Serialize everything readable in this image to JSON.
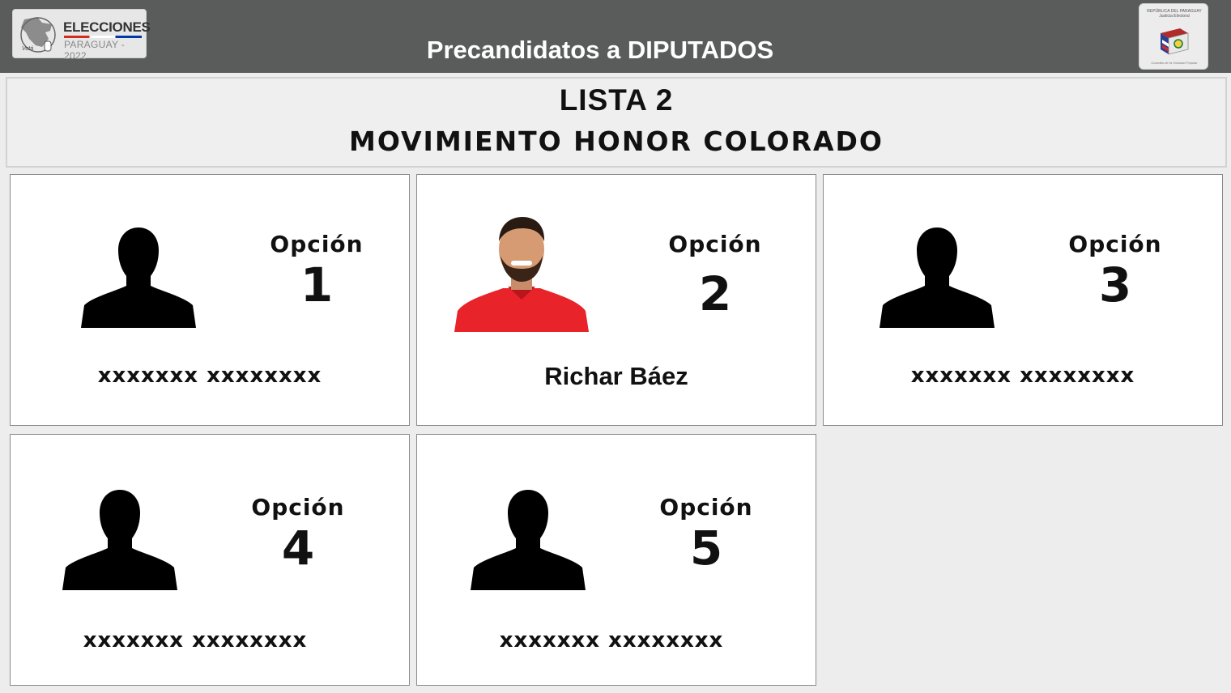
{
  "header": {
    "title": "Precandidatos a DIPUTADOS",
    "logo_left": {
      "title": "ELECCIONES",
      "subtitle": "PARAGUAY - 2022",
      "tagline": "Votá"
    },
    "logo_right": {
      "top_text": "REPÚBLICA DEL PARAGUAY Justicia Electoral",
      "bottom_text": "Custodio de la Voluntad Popular"
    }
  },
  "list": {
    "line1": "LISTA 2",
    "line2": "MOVIMIENTO HONOR COLORADO"
  },
  "candidates": [
    {
      "option_label": "Opción",
      "number": "1",
      "name": "xxxxxxx xxxxxxxx",
      "photo": "silhouette-icon"
    },
    {
      "option_label": "Opción",
      "number": "2",
      "name": "Richar Báez",
      "photo": "candidate-photo"
    },
    {
      "option_label": "Opción",
      "number": "3",
      "name": "xxxxxxx xxxxxxxx",
      "photo": "silhouette-icon"
    },
    {
      "option_label": "Opción",
      "number": "4",
      "name": "xxxxxxx xxxxxxxx",
      "photo": "silhouette-icon"
    },
    {
      "option_label": "Opción",
      "number": "5",
      "name": "xxxxxxx xxxxxxxx",
      "photo": "silhouette-icon"
    }
  ],
  "colors": {
    "topbar": "#5a5c5c",
    "background": "#ededed",
    "card_border": "#8a8a8a",
    "shirt_red": "#e8232a"
  }
}
